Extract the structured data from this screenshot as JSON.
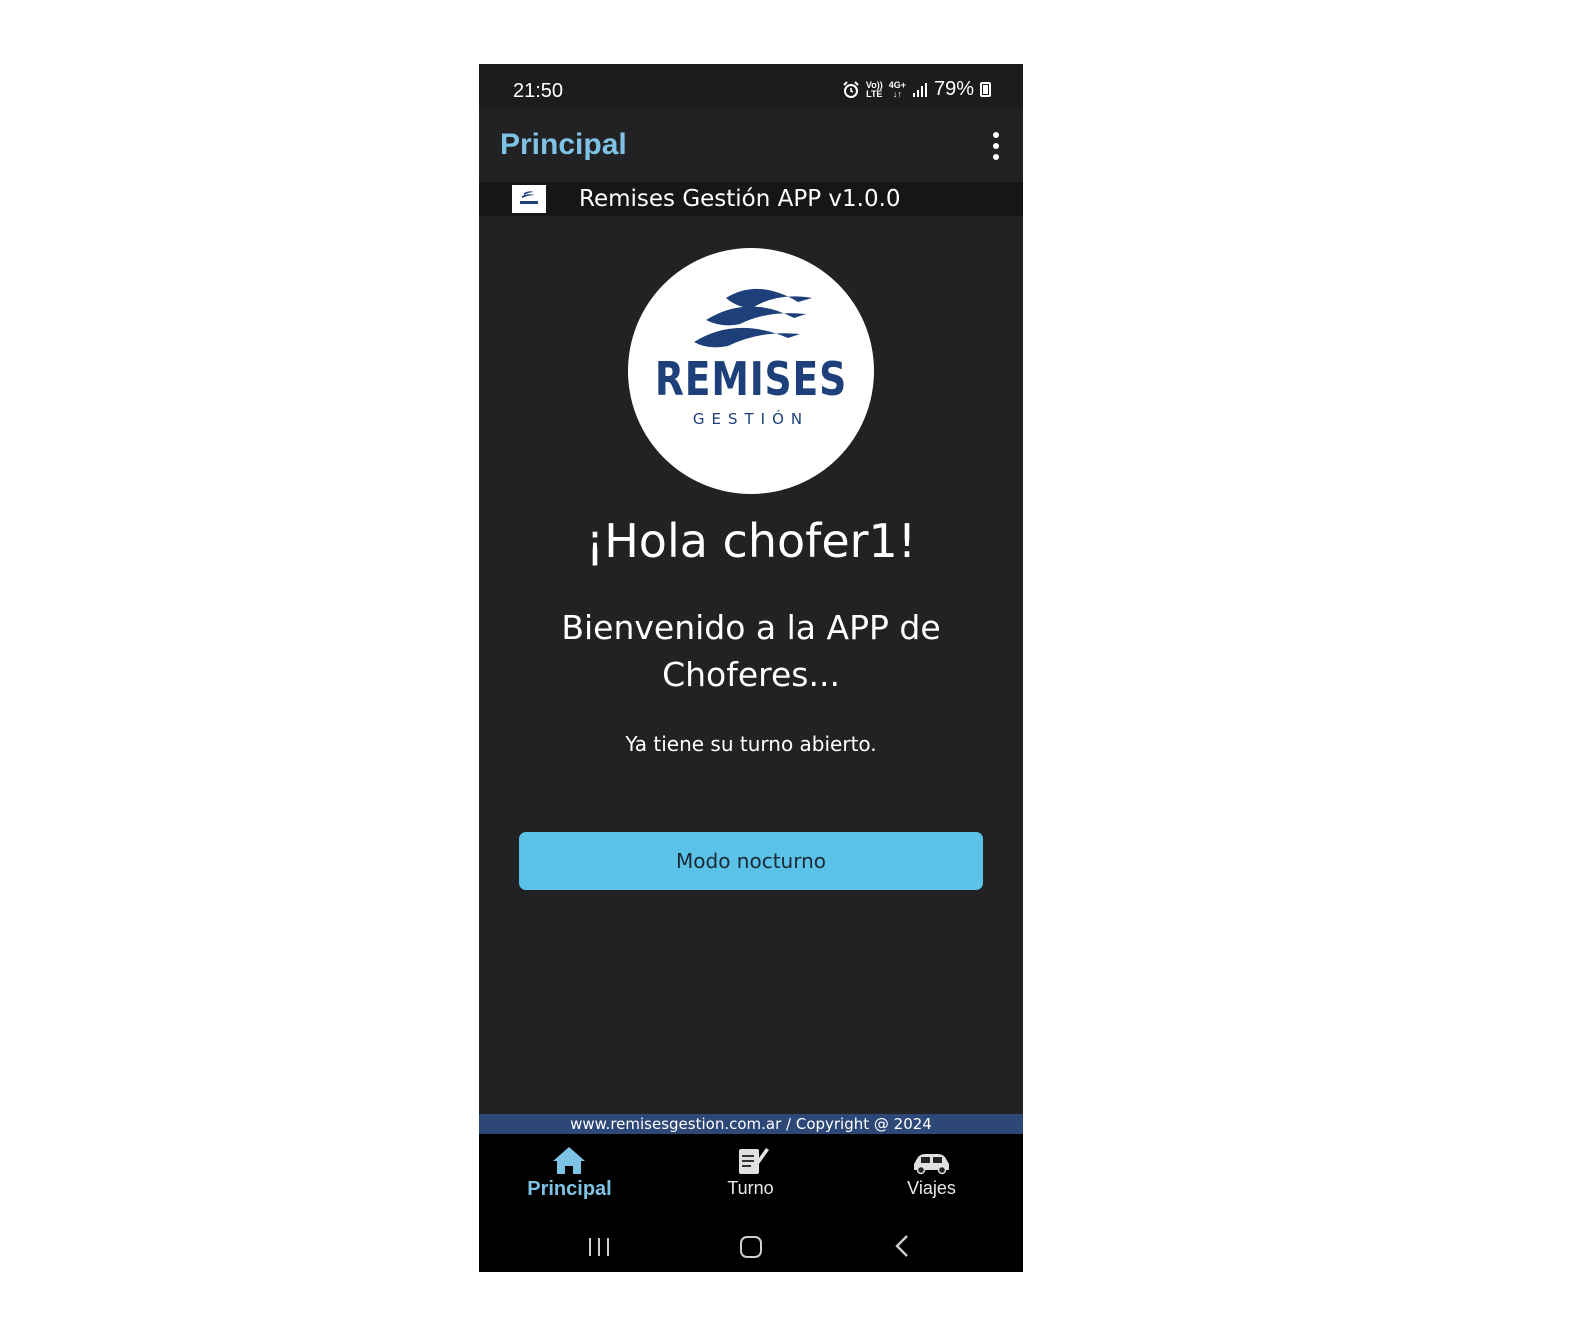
{
  "status_bar": {
    "time": "21:50",
    "volte_top": "Vo))",
    "volte_bottom": "LTE",
    "network": "4G+",
    "battery": "79%",
    "icons": [
      "alarm-icon",
      "volte-icon",
      "4g-icon",
      "signal-icon",
      "battery-icon"
    ]
  },
  "app_bar": {
    "title": "Principal",
    "menu_icon": "more-vertical-icon"
  },
  "version": {
    "text": "Remises Gestión APP v1.0.0"
  },
  "logo": {
    "word": "REMISES",
    "subword": "GESTIÓN",
    "brand_color": "#1d3f7a"
  },
  "main": {
    "greeting": "¡Hola chofer1!",
    "welcome": "Bienvenido a la APP de Choferes...",
    "turno_message": "Ya tiene su turno abierto.",
    "night_mode_button": "Modo nocturno"
  },
  "footer": {
    "text": "www.remisesgestion.com.ar / Copyright @ 2024"
  },
  "bottom_nav": {
    "items": [
      {
        "label": "Principal",
        "icon": "home-icon",
        "active": true
      },
      {
        "label": "Turno",
        "icon": "clipboard-icon",
        "active": false
      },
      {
        "label": "Viajes",
        "icon": "car-icon",
        "active": false
      }
    ]
  },
  "colors": {
    "accent": "#7ec3e6",
    "button": "#5bc3e8",
    "background": "#222224",
    "footer_strip": "#2d4777"
  }
}
